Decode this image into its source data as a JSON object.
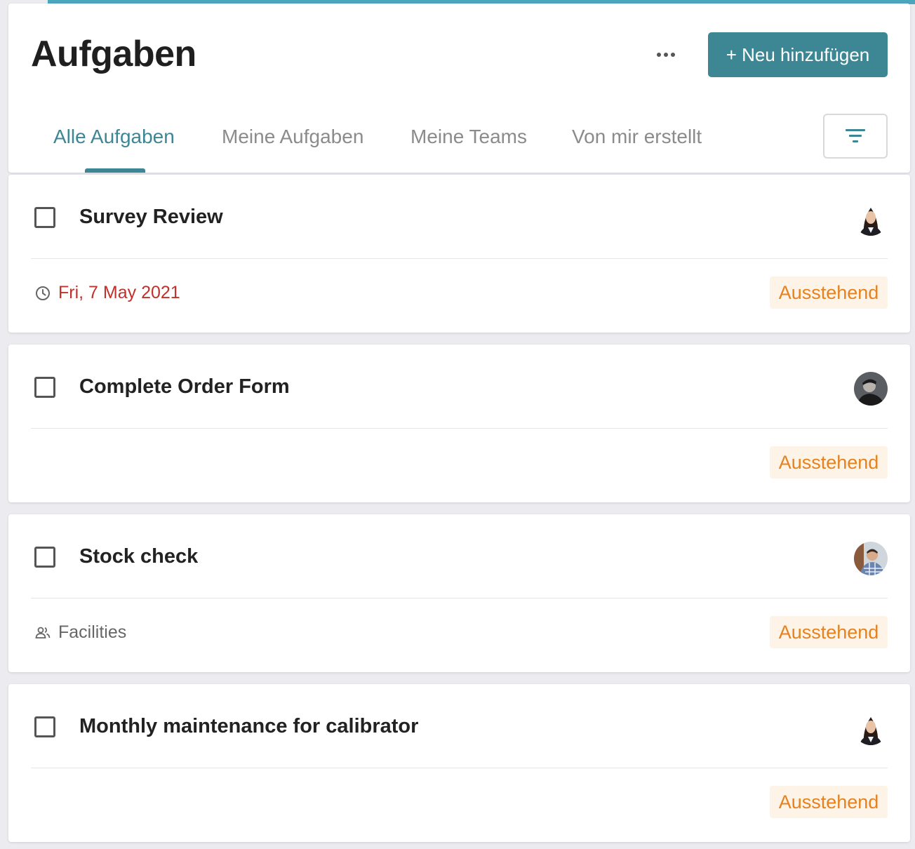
{
  "header": {
    "title": "Aufgaben",
    "add_label": "+ Neu hinzufügen"
  },
  "tabs": [
    {
      "label": "Alle Aufgaben",
      "active": true
    },
    {
      "label": "Meine Aufgaben",
      "active": false
    },
    {
      "label": "Meine Teams",
      "active": false
    },
    {
      "label": "Von mir erstellt",
      "active": false
    }
  ],
  "tasks": [
    {
      "title": "Survey Review",
      "meta": "Fri, 7 May 2021",
      "meta_type": "due-date",
      "status": "Ausstehend",
      "assignee_avatar": "woman-avatar"
    },
    {
      "title": "Complete Order Form",
      "meta": "",
      "status": "Ausstehend",
      "assignee_avatar": "man-dark-avatar"
    },
    {
      "title": "Stock check",
      "meta": "Facilities",
      "meta_type": "team",
      "status": "Ausstehend",
      "assignee_avatar": "man-plaid-avatar"
    },
    {
      "title": "Monthly maintenance for calibrator",
      "meta": "",
      "status": "Ausstehend",
      "assignee_avatar": "woman-avatar"
    }
  ],
  "colors": {
    "accent": "#3d8794",
    "due_date": "#c0312b",
    "status_text": "#e5821f",
    "status_bg": "#fdf3e6"
  }
}
